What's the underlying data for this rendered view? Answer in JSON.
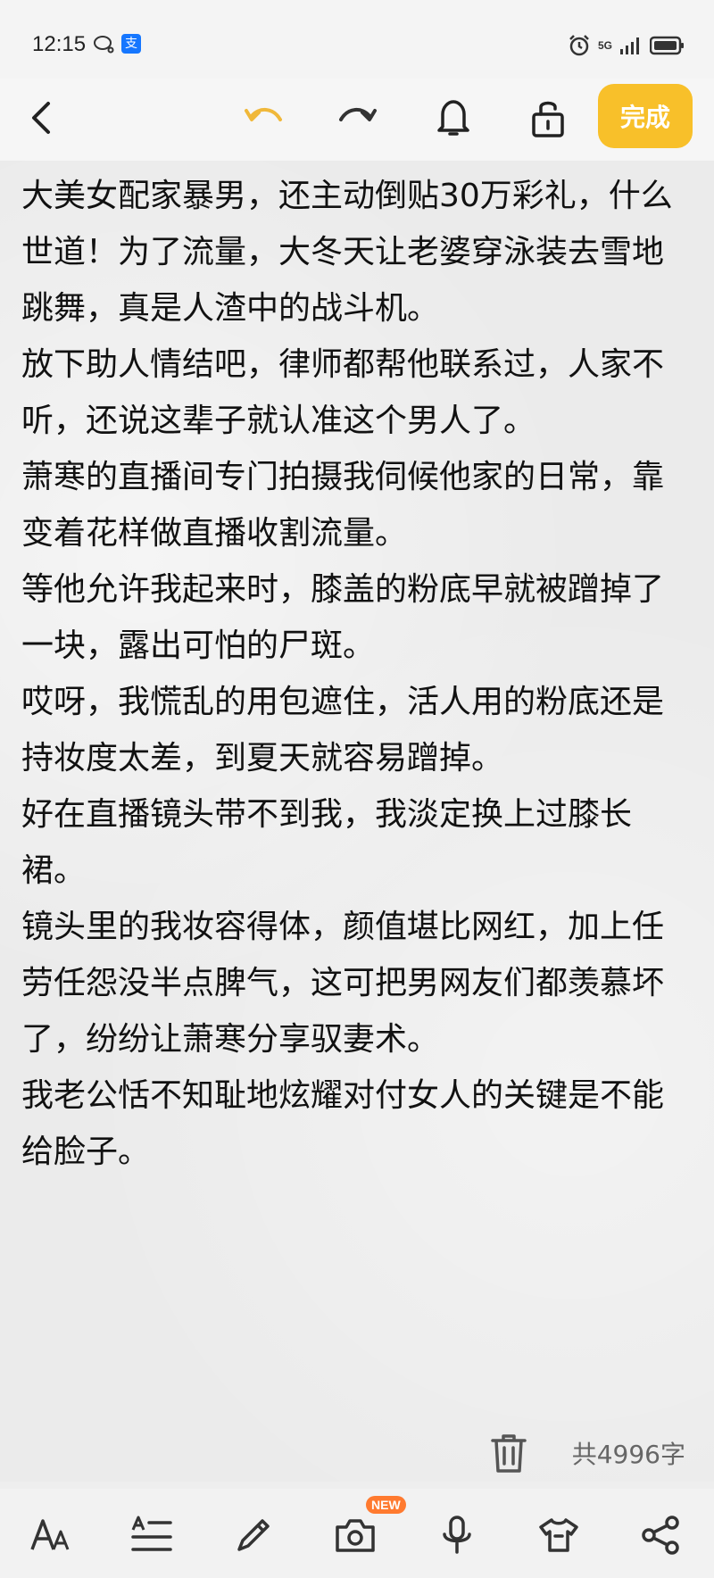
{
  "status_bar": {
    "time": "12:15",
    "alipay_glyph": "支",
    "network": "5G"
  },
  "toolbar": {
    "done_label": "完成"
  },
  "note": {
    "paragraphs": [
      "大美女配家暴男，还主动倒贴30万彩礼，什么世道！为了流量，大冬天让老婆穿泳装去雪地跳舞，真是人渣中的战斗机。",
      "放下助人情结吧，律师都帮他联系过，人家不听，还说这辈子就认准这个男人了。",
      "萧寒的直播间专门拍摄我伺候他家的日常，靠变着花样做直播收割流量。",
      "等他允许我起来时，膝盖的粉底早就被蹭掉了一块，露出可怕的尸斑。",
      "哎呀，我慌乱的用包遮住，活人用的粉底还是持妆度太差，到夏天就容易蹭掉。",
      "好在直播镜头带不到我，我淡定换上过膝长裙。",
      "镜头里的我妆容得体，颜值堪比网红，加上任劳任怨没半点脾气，这可把男网友们都羡慕坏了，纷纷让萧寒分享驭妻术。",
      "我老公恬不知耻地炫耀对付女人的关键是不能给脸子。"
    ]
  },
  "footer": {
    "word_count": "共4996字"
  },
  "bottom_bar": {
    "new_badge": "NEW"
  },
  "colors": {
    "accent": "#f8c02a",
    "undo_active": "#f0b83a",
    "badge": "#ff7a2f"
  }
}
